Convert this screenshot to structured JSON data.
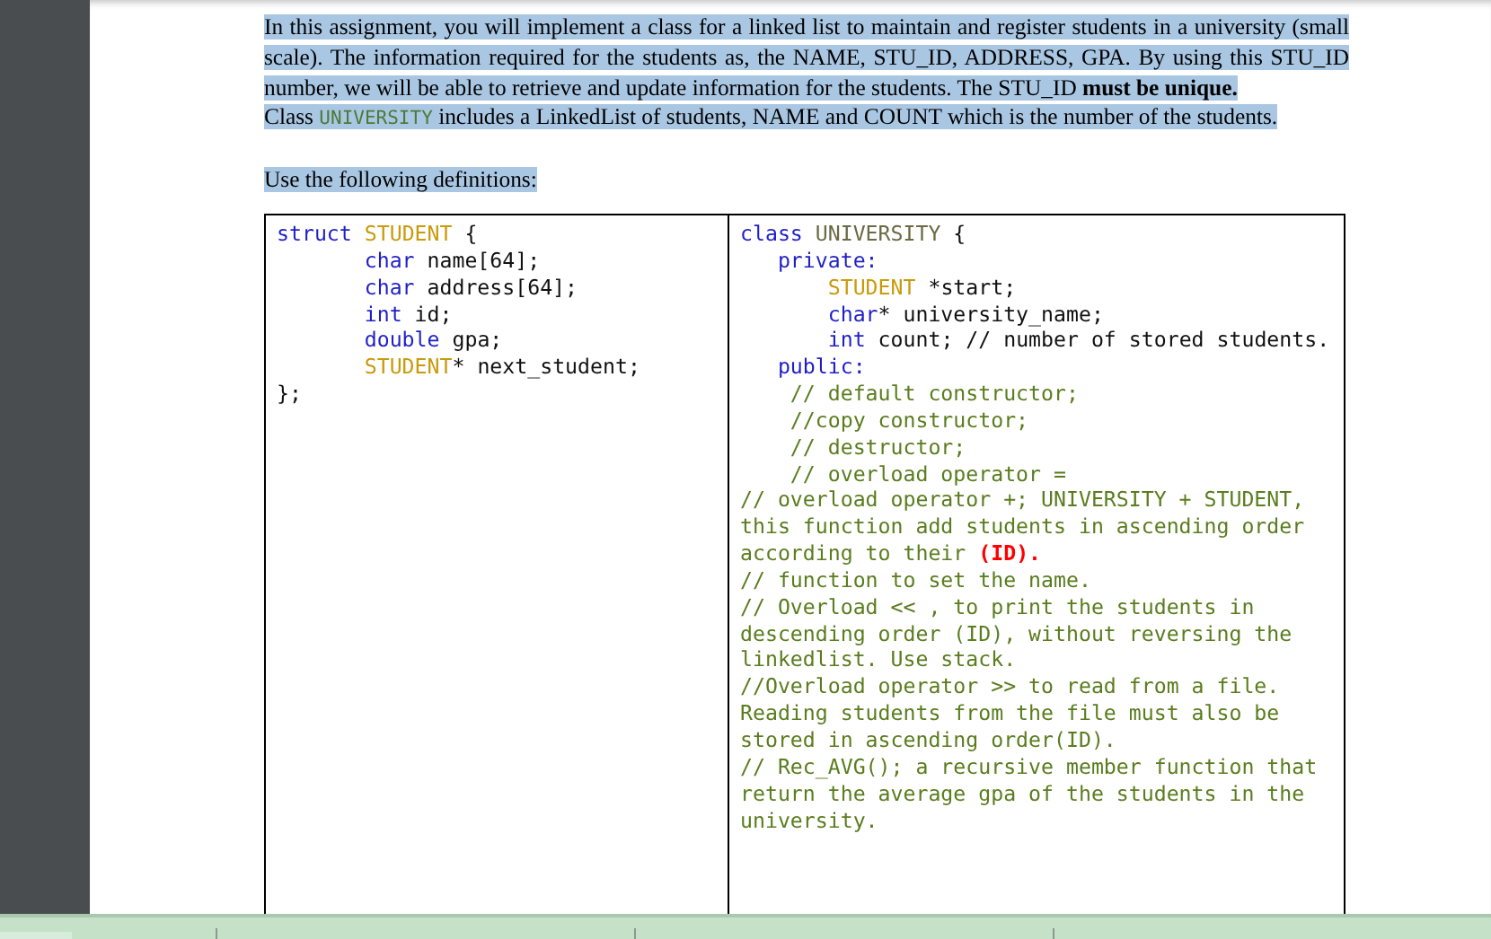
{
  "intro": {
    "highlighted": true,
    "text": "In this assignment, you will implement a class for a linked list to maintain and register students in a university (small scale). The information required for the students as, the NAME, STU_ID, ADDRESS, GPA. By using this STU_ID number, we will be able to retrieve and update information for the students. The STU_ID **must be unique.**"
  },
  "class_note": {
    "highlighted": true,
    "segments": [
      {
        "kind": "text",
        "text": "Class "
      },
      {
        "kind": "code",
        "text": "UNIVERSITY"
      },
      {
        "kind": "text",
        "text": "  includes a  LinkedList of students, NAME and COUNT which is the number of the students."
      }
    ]
  },
  "lead_in": {
    "highlighted": true,
    "text": "Use the following definitions:"
  },
  "table": {
    "left": [
      [
        {
          "kind": "keyword",
          "text": "struct "
        },
        {
          "kind": "type",
          "text": "STUDENT"
        },
        {
          "kind": "plain",
          "text": " {"
        }
      ],
      [
        {
          "kind": "keyword",
          "text": "       char"
        },
        {
          "kind": "plain",
          "text": " name[64];"
        }
      ],
      [
        {
          "kind": "keyword",
          "text": "       char"
        },
        {
          "kind": "plain",
          "text": " address[64];"
        }
      ],
      [
        {
          "kind": "keyword",
          "text": "       int"
        },
        {
          "kind": "plain",
          "text": " id;"
        }
      ],
      [
        {
          "kind": "keyword",
          "text": "       double"
        },
        {
          "kind": "plain",
          "text": " gpa;"
        }
      ],
      [
        {
          "kind": "type",
          "text": "       STUDENT"
        },
        {
          "kind": "plain",
          "text": "* next_student;"
        }
      ],
      [
        {
          "kind": "plain",
          "text": "};"
        }
      ]
    ],
    "right": [
      [
        {
          "kind": "keyword",
          "text": "class "
        },
        {
          "kind": "name",
          "text": "UNIVERSITY"
        },
        {
          "kind": "plain",
          "text": " {"
        }
      ],
      [
        {
          "kind": "keyword",
          "text": "   private:"
        }
      ],
      [
        {
          "kind": "type",
          "text": "       STUDENT"
        },
        {
          "kind": "plain",
          "text": " *start;"
        }
      ],
      [
        {
          "kind": "keyword",
          "text": "       char"
        },
        {
          "kind": "plain",
          "text": "* university_name;"
        }
      ],
      [
        {
          "kind": "keyword",
          "text": "       int"
        },
        {
          "kind": "plain",
          "text": " count; // number of stored students."
        }
      ],
      [
        {
          "kind": "keyword",
          "text": "   public:"
        }
      ],
      [
        {
          "kind": "comment",
          "text": "    // default constructor;"
        }
      ],
      [
        {
          "kind": "comment",
          "text": "    //copy constructor;"
        }
      ],
      [
        {
          "kind": "comment",
          "text": "    // destructor;"
        }
      ],
      [
        {
          "kind": "comment",
          "text": "    // overload operator ="
        }
      ],
      [
        {
          "kind": "comment",
          "text": "// overload operator +; UNIVERSITY + STUDENT,"
        }
      ],
      [
        {
          "kind": "comment",
          "text": "this function add students in ascending order"
        }
      ],
      [
        {
          "kind": "comment",
          "text": "according to their "
        },
        {
          "kind": "alert",
          "text": "(ID)."
        }
      ],
      [
        {
          "kind": "comment",
          "text": "// function to set the name."
        }
      ],
      [
        {
          "kind": "comment",
          "text": "// Overload << , to print the students in"
        }
      ],
      [
        {
          "kind": "comment",
          "text": "descending order (ID), without reversing the"
        }
      ],
      [
        {
          "kind": "comment",
          "text": "linkedlist. Use stack."
        }
      ],
      [
        {
          "kind": "comment",
          "text": "//Overload operator >> to read from a file."
        }
      ],
      [
        {
          "kind": "comment",
          "text": "Reading students from the file must also be"
        }
      ],
      [
        {
          "kind": "comment",
          "text": "stored in ascending order(ID)."
        }
      ],
      [
        {
          "kind": "comment",
          "text": "// Rec_AVG(); a recursive member function that"
        }
      ],
      [
        {
          "kind": "comment",
          "text": "return the average gpa of the students in the"
        }
      ],
      [
        {
          "kind": "comment",
          "text": "university."
        }
      ]
    ]
  }
}
